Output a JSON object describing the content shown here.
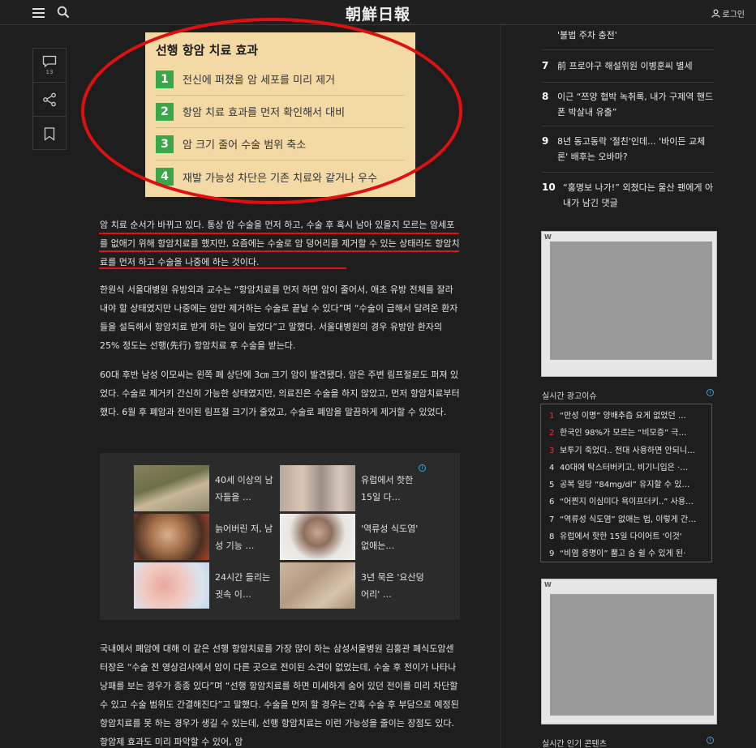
{
  "header": {
    "logo": "朝鮮日報",
    "login_label": "로그인"
  },
  "share": {
    "comment_count": "13"
  },
  "info_box": {
    "title": "선행 항암 치료 효과",
    "items": [
      {
        "num": "1",
        "text": "전신에 퍼졌을 암 세포를 미리 제거"
      },
      {
        "num": "2",
        "text": "항암 치료 효과를 먼저 확인해서 대비"
      },
      {
        "num": "3",
        "text": "암 크기 줄어 수술 범위 축소"
      },
      {
        "num": "4",
        "text": "재발 가능성 차단은 기존 치료와 같거나 우수"
      }
    ]
  },
  "article": {
    "lead": "암 치료 순서가 바뀌고 있다. 통상 암 수술을 먼저 하고, 수술 후 혹시 남아 있을지 모르는 암세포를 없애기 위해 항암치료를 했지만, 요즘에는 수술로 암 덩어리를 제거할 수 있는 상태라도 항암치료를 먼저 하고 수술을 나중에 하는 것이다.",
    "p2": "한원식 서울대병원 유방외과 교수는 “항암치료를 먼저 하면 암이 줄어서, 애초 유방 전체를 잘라내야 할 상태였지만 나중에는 암만 제거하는 수술로 끝날 수 있다”며 “수술이 급해서 달려온 환자들을 설득해서 항암치료 받게 하는 일이 늘었다”고 말했다. 서울대병원의 경우 유방암 환자의 25% 정도는 선행(先行) 항암치료 후 수술을 받는다.",
    "p3": "60대 후반 남성 이모씨는 왼쪽 폐 상단에 3㎝ 크기 암이 발견됐다. 암은 주변 림프절로도 퍼져 있었다. 수술로 제거키 간신히 가능한 상태였지만, 의료진은 수술을 하지 않았고, 먼저 항암치료부터 했다. 6월 후 폐암과 전이된 림프절 크기가 줄었고, 수술로 폐암을 말끔하게 제거할 수 있었다.",
    "p4": "국내에서 폐암에 대해 이 같은 선행 항암치료를 가장 많이 하는 삼성서울병원 김홍관 폐식도암센터장은 “수술 전 영상검사에서 암이 다른 곳으로 전이된 소견이 없었는데, 수술 후 전이가 나타나 낭패를 보는 경우가 종종 있다”며 “선행 항암치료를 하면 미세하게 숨어 있던 전이를 미리 차단할 수 있고 수술 범위도 간결해진다”고 말했다. 수술을 먼저 할 경우는 간혹 수술 후 부담으로 예정된 항암치료를 못 하는 경우가 생길 수 있는데, 선행 항암치료는 이런 가능성을 줄이는 장점도 있다. 항암제 효과도 미리 파악할 수 있어, 암"
  },
  "ad_grid": {
    "info": "i",
    "items": [
      {
        "text": "40세 이상의 남자들을 …"
      },
      {
        "text": "유럽에서 핫한 15일 다…"
      },
      {
        "text": "늙어버린 저, 남성 기능 …"
      },
      {
        "text": "'역류성 식도염' 없애는…"
      },
      {
        "text": "24시간 들리는 귓속 이…"
      },
      {
        "text": "3년 묵은 '요산덩어리' …"
      }
    ]
  },
  "ranking": [
    {
      "num": "",
      "title": "'불법 주차 충전'"
    },
    {
      "num": "7",
      "title": "前 프로야구 해설위원 이병훈씨 별세"
    },
    {
      "num": "8",
      "title": "이근 “쯔양 협박 녹취록, 내가 구제역 핸드폰 박살내 유출”"
    },
    {
      "num": "9",
      "title": "8년 동고동락 '절친'인데... '바이든 교체론' 배후는 오바마?"
    },
    {
      "num": "10",
      "title": "“홍명보 나가!” 외쳤다는 울산 팬에게 아내가 남긴 댓글"
    }
  ],
  "live_issue": {
    "heading": "실시간 광고이슈",
    "info": "i",
    "items": [
      {
        "num": "1",
        "text": "“만성 이명” 양배추즙 요게 없었던 …",
        "color": "#e53935"
      },
      {
        "num": "2",
        "text": "한국인 98%가 모르는 “비모증” 극…",
        "color": "#e53935"
      },
      {
        "num": "3",
        "text": "보투기 죽었다.. 전대 사용하면 안되니…",
        "color": "#e53935"
      },
      {
        "num": "4",
        "text": "40대에 탁스터버키고, 비기니입은 ·…",
        "color": "#e8e8e8"
      },
      {
        "num": "5",
        "text": "공복 일당 “84mg/dl” 유지할 수 있…",
        "color": "#e8e8e8"
      },
      {
        "num": "6",
        "text": "“어찐지 이심미다 욕이프더키..” 사용…",
        "color": "#e8e8e8"
      },
      {
        "num": "7",
        "text": "“역류성 식도염” 없애는 법, 이렇게 간…",
        "color": "#e8e8e8"
      },
      {
        "num": "8",
        "text": "유럽에서 핫한 15일 다이어트 '이것'",
        "color": "#e8e8e8"
      },
      {
        "num": "9",
        "text": "“비염 증명이” 뿜고 숨 쉴 수 있게 된·",
        "color": "#e8e8e8"
      }
    ]
  },
  "popular": {
    "heading": "실시간 인기 콘텐츠",
    "info": "i"
  },
  "ads": {
    "badge": "W"
  }
}
